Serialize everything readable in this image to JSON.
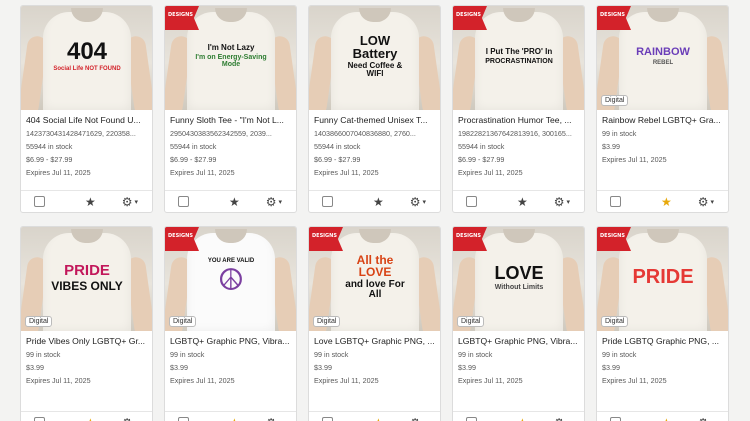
{
  "cards": [
    {
      "ribbon": "",
      "badge": "",
      "art": [
        "404",
        "Social Life NOT FOUND"
      ],
      "title": "404 Social Life Not Found U...",
      "lines": [
        "1423730431428471629, 220358...",
        "55944 in stock",
        "$6.99 - $27.99",
        "Expires Jul 11, 2025"
      ],
      "favorite": false
    },
    {
      "ribbon": "DESIGNS",
      "badge": "",
      "art": [
        "I'm Not Lazy",
        "I'm on Energy-Saving Mode"
      ],
      "title": "Funny Sloth Tee - \"I'm Not L...",
      "lines": [
        "2950430383562342559, 2039...",
        "55944 in stock",
        "$6.99 - $27.99",
        "Expires Jul 11, 2025"
      ],
      "favorite": false
    },
    {
      "ribbon": "",
      "badge": "",
      "art": [
        "LOW Battery",
        "Need Coffee & WIFI"
      ],
      "title": "Funny Cat-themed Unisex T...",
      "lines": [
        "1403866007040836880, 2760...",
        "55944 in stock",
        "$6.99 - $27.99",
        "Expires Jul 11, 2025"
      ],
      "favorite": false
    },
    {
      "ribbon": "DESIGNS",
      "badge": "",
      "art": [
        "I Put The 'PRO' In",
        "PROCRASTINATION"
      ],
      "title": "Procrastination Humor Tee, ...",
      "lines": [
        "1982282136764281391​6, 300165...",
        "55944 in stock",
        "$6.99 - $27.99",
        "Expires Jul 11, 2025"
      ],
      "favorite": false
    },
    {
      "ribbon": "DESIGNS",
      "badge": "Digital",
      "art": [
        "RAINBOW",
        "REBEL"
      ],
      "title": "Rainbow Rebel LGBTQ+ Gra...",
      "lines": [
        "99 in stock",
        "$3.99",
        "Expires Jul 11, 2025"
      ],
      "favorite": true
    },
    {
      "ribbon": "",
      "badge": "Digital",
      "art": [
        "PRIDE",
        "VIBES ONLY"
      ],
      "title": "Pride Vibes Only LGBTQ+ Gr...",
      "lines": [
        "99 in stock",
        "$3.99",
        "Expires Jul 11, 2025"
      ],
      "favorite": true
    },
    {
      "ribbon": "DESIGNS",
      "badge": "Digital",
      "art": [
        "YOU ARE VALID",
        "☮"
      ],
      "title": "LGBTQ+ Graphic PNG, Vibra...",
      "lines": [
        "99 in stock",
        "$3.99",
        "Expires Jul 11, 2025"
      ],
      "favorite": true
    },
    {
      "ribbon": "DESIGNS",
      "badge": "Digital",
      "art": [
        "All the LOVE",
        "and love For All"
      ],
      "title": "Love LGBTQ+ Graphic PNG, ...",
      "lines": [
        "99 in stock",
        "$3.99",
        "Expires Jul 11, 2025"
      ],
      "favorite": true
    },
    {
      "ribbon": "DESIGNS",
      "badge": "Digital",
      "art": [
        "LOVE",
        "Without Limits"
      ],
      "title": "LGBTQ+ Graphic PNG, Vibra...",
      "lines": [
        "99 in stock",
        "$3.99",
        "Expires Jul 11, 2025"
      ],
      "favorite": true
    },
    {
      "ribbon": "DESIGNS",
      "badge": "Digital",
      "art": [
        "PRIDE",
        ""
      ],
      "title": "Pride LGBTQ Graphic PNG, ...",
      "lines": [
        "99 in stock",
        "$3.99",
        "Expires Jul 11, 2025"
      ],
      "favorite": true
    }
  ],
  "icons": {
    "star": "star-icon",
    "gear": "gear-icon",
    "caret": "caret-down-icon",
    "checkbox": "checkbox"
  },
  "colors": {
    "favorite": "#e8a90c",
    "ribbon": "#d3222a"
  }
}
